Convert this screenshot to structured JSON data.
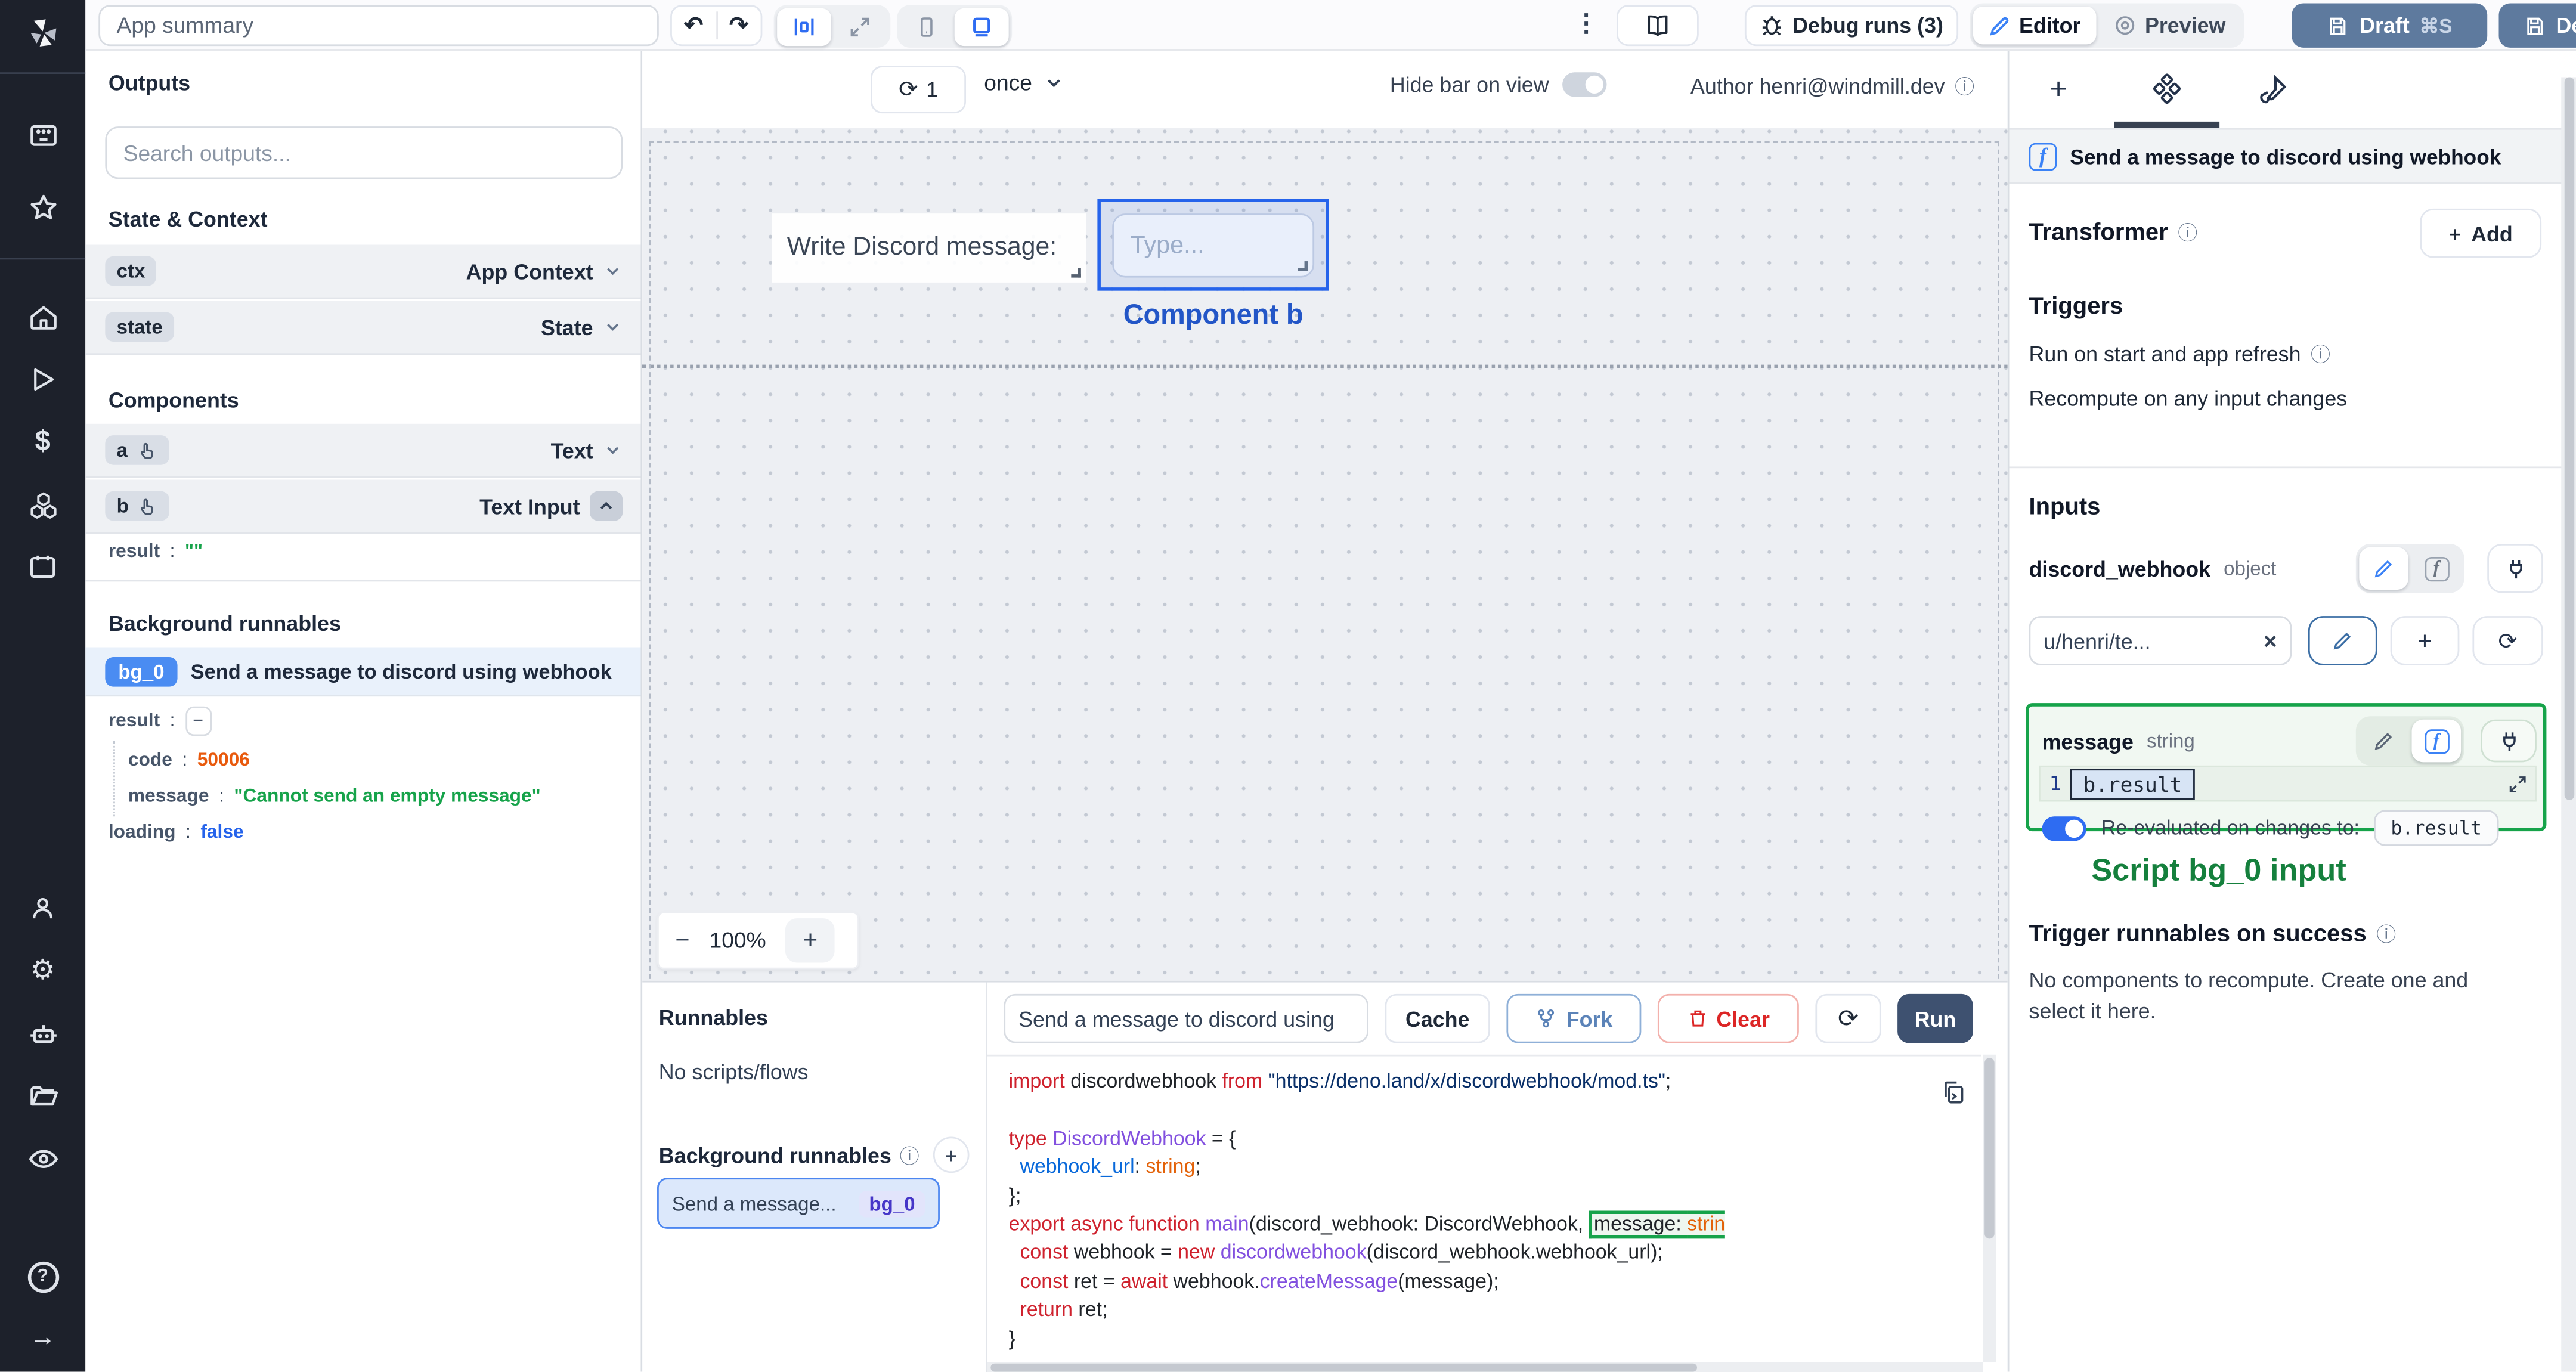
{
  "icons": {
    "undo": "↶",
    "redo": "↷",
    "kebab": "⋮",
    "info": "ⓘ",
    "close": "×",
    "minus": "−",
    "plus": "+",
    "refresh": "⟳",
    "gear": "⚙",
    "dollar": "$",
    "help": "?",
    "arrow_right": "→",
    "cmd_s": "⌘S"
  },
  "topbar": {
    "app_summary": "App summary",
    "debug_runs": "Debug runs (3)",
    "editor": "Editor",
    "preview": "Preview",
    "draft": "Draft",
    "deploy": "Deploy"
  },
  "canvas_toolbar": {
    "refresh_count": "1",
    "mode": "once",
    "hide_bar_label": "Hide bar on view",
    "author_label": "Author henri@windmill.dev"
  },
  "outputs_panel": {
    "title": "Outputs",
    "search_placeholder": "Search outputs...",
    "state_context_title": "State & Context",
    "ctx_key": "ctx",
    "ctx_type": "App Context",
    "state_key": "state",
    "state_type": "State",
    "components_title": "Components",
    "comp_a_key": "a",
    "comp_a_type": "Text",
    "comp_b_key": "b",
    "comp_b_type": "Text Input",
    "b_result_key": "result",
    "b_result_value": "\"\"",
    "bg_title": "Background runnables",
    "bg0_badge": "bg_0",
    "bg0_name": "Send a message to discord using webhook",
    "result_key": "result",
    "code_key": "code",
    "code_value": "50006",
    "message_key": "message",
    "message_value": "\"Cannot send an empty message\"",
    "loading_key": "loading",
    "loading_value": "false"
  },
  "canvas": {
    "text_component": "Write Discord message:",
    "input_placeholder": "Type...",
    "selected_label": "Component b",
    "zoom_level": "100%"
  },
  "runnables_panel": {
    "title": "Runnables",
    "empty": "No scripts/flows",
    "bg_title": "Background runnables",
    "item_label": "Send a message...",
    "item_badge": "bg_0"
  },
  "code_panel": {
    "script_name": "Send a message to discord using",
    "cache": "Cache",
    "fork": "Fork",
    "clear": "Clear",
    "run": "Run",
    "lines": [
      [
        {
          "t": "import ",
          "c": "k"
        },
        {
          "t": "discordwebhook ",
          "c": "d"
        },
        {
          "t": "from ",
          "c": "k"
        },
        {
          "t": "\"https://deno.land/x/discordwebhook/mod.ts\"",
          "c": "s"
        },
        {
          "t": ";",
          "c": "d"
        }
      ],
      [],
      [
        {
          "t": "type ",
          "c": "k"
        },
        {
          "t": "DiscordWebhook ",
          "c": "p"
        },
        {
          "t": "= {",
          "c": "d"
        }
      ],
      [
        {
          "t": "  ",
          "c": "d"
        },
        {
          "t": "webhook_url",
          "c": "b"
        },
        {
          "t": ": ",
          "c": "d"
        },
        {
          "t": "string",
          "c": "o"
        },
        {
          "t": ";",
          "c": "d"
        }
      ],
      [
        {
          "t": "};",
          "c": "d"
        }
      ],
      [
        {
          "t": "export async function ",
          "c": "k"
        },
        {
          "t": "main",
          "c": "p"
        },
        {
          "t": "(discord_webhook: DiscordWebhook, ",
          "c": "d"
        },
        {
          "t": "message: ",
          "c": "d hl-l"
        },
        {
          "t": "strin",
          "c": "o hl-r"
        }
      ],
      [
        {
          "t": "  ",
          "c": "d"
        },
        {
          "t": "const ",
          "c": "k"
        },
        {
          "t": "webhook = ",
          "c": "d"
        },
        {
          "t": "new ",
          "c": "k"
        },
        {
          "t": "discordwebhook",
          "c": "p"
        },
        {
          "t": "(discord_webhook.webhook_url);",
          "c": "d"
        }
      ],
      [
        {
          "t": "  ",
          "c": "d"
        },
        {
          "t": "const ",
          "c": "k"
        },
        {
          "t": "ret = ",
          "c": "d"
        },
        {
          "t": "await ",
          "c": "k"
        },
        {
          "t": "webhook.",
          "c": "d"
        },
        {
          "t": "createMessage",
          "c": "p"
        },
        {
          "t": "(message);",
          "c": "d"
        }
      ],
      [
        {
          "t": "  ",
          "c": "d"
        },
        {
          "t": "return ",
          "c": "k"
        },
        {
          "t": "ret;",
          "c": "d"
        }
      ],
      [
        {
          "t": "}",
          "c": "d"
        }
      ]
    ]
  },
  "right_panel": {
    "header": "Send a message to discord using webhook",
    "transformer_title": "Transformer",
    "add_label": "Add",
    "triggers_title": "Triggers",
    "trigger_run_on_start": "Run on start and app refresh",
    "trigger_recompute": "Recompute on any input changes",
    "inputs_title": "Inputs",
    "input1_name": "discord_webhook",
    "input1_type": "object",
    "input1_value": "u/henri/te...",
    "input2_name": "message",
    "input2_type": "string",
    "input2_line_no": "1",
    "input2_value": "b.result",
    "reeval_label": "Re-evaluated on changes to:",
    "reeval_value": "b.result",
    "script_input_label": "Script bg_0 input",
    "trigger_success_title": "Trigger runnables on success",
    "no_components_text": "No components to recompute. Create one and select it here."
  },
  "colors": {
    "accent": "#2e6cf2",
    "slate_button": "#5e7a9e",
    "run_button": "#3e5170",
    "green": "#16a34a",
    "orange": "#e8590c",
    "value_blue": "#2563eb",
    "selection_border": "#2563eb",
    "rail_bg": "#1d212b"
  }
}
